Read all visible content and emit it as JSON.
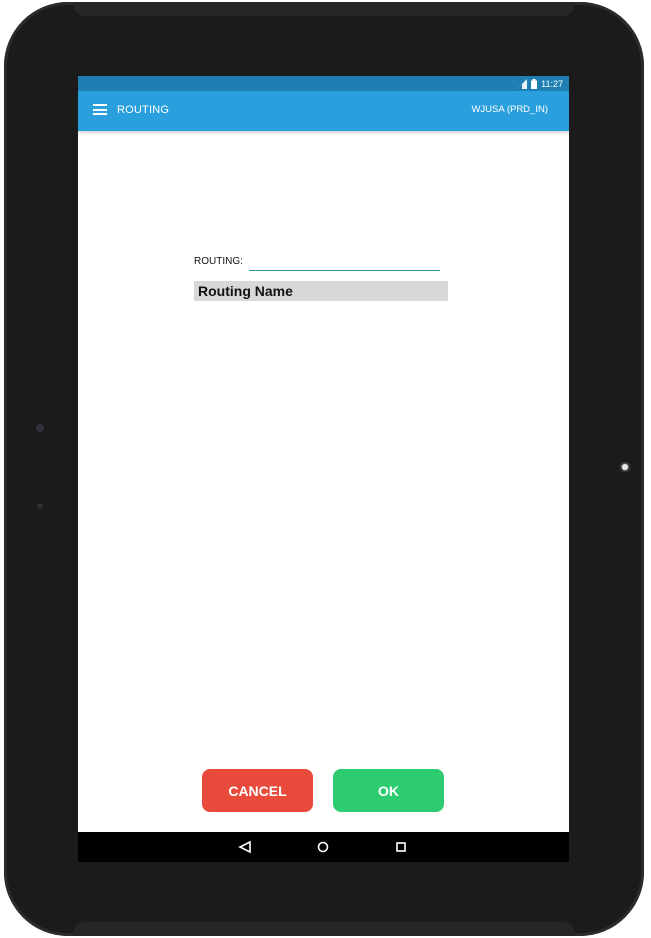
{
  "status_bar": {
    "time": "11:27",
    "icons": [
      "signal-icon",
      "battery-icon"
    ]
  },
  "app_bar": {
    "menu_icon": "menu-icon",
    "title": "ROUTING",
    "environment": "WJUSA (PRD_IN)"
  },
  "form": {
    "routing_label": "ROUTING:",
    "routing_value": "",
    "routing_placeholder": "",
    "routing_name_header": "Routing Name"
  },
  "buttons": {
    "cancel_label": "CANCEL",
    "ok_label": "OK"
  },
  "nav_bar": {
    "icons": [
      "back-icon",
      "home-icon",
      "recents-icon"
    ]
  },
  "colors": {
    "status_bar": "#1f7fb3",
    "app_bar": "#29a0dd",
    "cancel": "#e84a3c",
    "ok": "#2ecc71",
    "input_underline": "#2b8c8c",
    "header_bg": "#d8d8d8"
  }
}
